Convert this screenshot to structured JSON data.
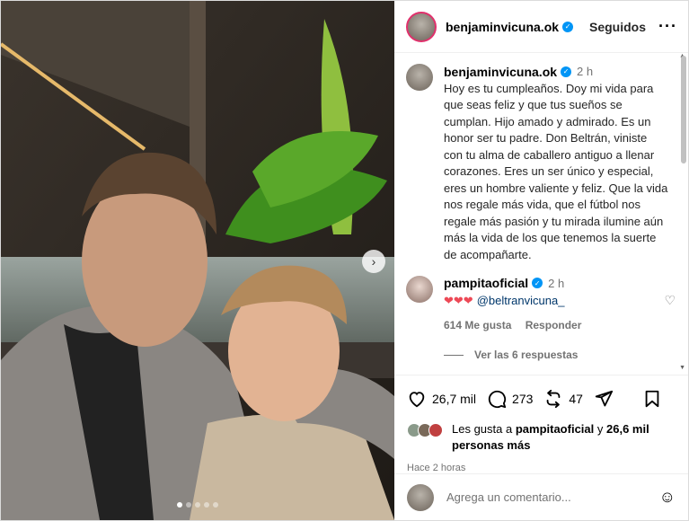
{
  "post": {
    "username": "benjaminvicuna.ok",
    "follow_label": "Seguidos",
    "more_label": "···",
    "next_label": "›",
    "slides": 5,
    "active_slide": 1
  },
  "caption": {
    "username": "benjaminvicuna.ok",
    "time": "2 h",
    "text": "Hoy es tu cumpleaños. Doy mi vida para que seas feliz y que tus sueños se cumplan. Hijo amado y admirado. Es un honor ser tu padre. Don Beltrán, viniste con tu alma de caballero antiguo a llenar corazones. Eres un ser único y especial, eres un hombre valiente y feliz. Que la vida nos regale más vida, que el fútbol nos regale más pasión y tu mirada ilumine aún más la vida de los que tenemos la suerte de acompañarte."
  },
  "reply": {
    "username": "pampitaoficial",
    "time": "2 h",
    "hearts": "❤❤❤",
    "mention": "@beltranvicuna_",
    "likes": "614 Me gusta",
    "reply_label": "Responder",
    "view_replies": "Ver las 6 respuestas"
  },
  "actions": {
    "likes": "26,7 mil",
    "comments": "273",
    "reposts": "47"
  },
  "liked_by": {
    "prefix": "Les gusta a",
    "user": "pampitaoficial",
    "and": "y",
    "count": "26,6 mil",
    "suffix": "personas más"
  },
  "ago": "Hace 2 horas",
  "add_comment": {
    "placeholder": "Agrega un comentario..."
  },
  "icons": {
    "verified": "verified-icon",
    "heart": "heart-icon",
    "comment": "comment-icon",
    "repost": "repost-icon",
    "share": "share-icon",
    "save": "bookmark-icon",
    "emoji": "emoji-icon"
  },
  "colors": {
    "verified": "#0095f6",
    "heart": "#ed4956",
    "mention": "#00376b",
    "muted": "#737373"
  }
}
